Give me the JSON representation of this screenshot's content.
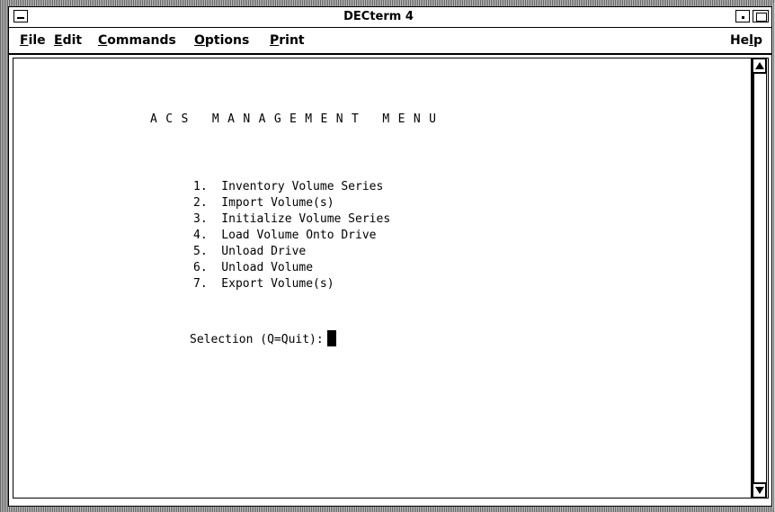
{
  "window": {
    "title": "DECterm 4"
  },
  "menubar": {
    "items": [
      {
        "mnemonic": "F",
        "rest": "ile"
      },
      {
        "mnemonic": "E",
        "rest": "dit"
      },
      {
        "mnemonic": "C",
        "rest": "ommands"
      },
      {
        "mnemonic": "O",
        "rest": "ptions"
      },
      {
        "mnemonic": "P",
        "rest": "rint"
      }
    ],
    "help": {
      "lead": "He",
      "mnemonic": "l",
      "rest": "p"
    }
  },
  "terminal": {
    "heading": "ACS MANAGEMENT MENU",
    "options": [
      "1.  Inventory Volume Series",
      "2.  Import Volume(s)",
      "3.  Initialize Volume Series",
      "4.  Load Volume Onto Drive",
      "5.  Unload Drive",
      "6.  Unload Volume",
      "7.  Export Volume(s)"
    ],
    "prompt": "Selection (Q=Quit):"
  }
}
